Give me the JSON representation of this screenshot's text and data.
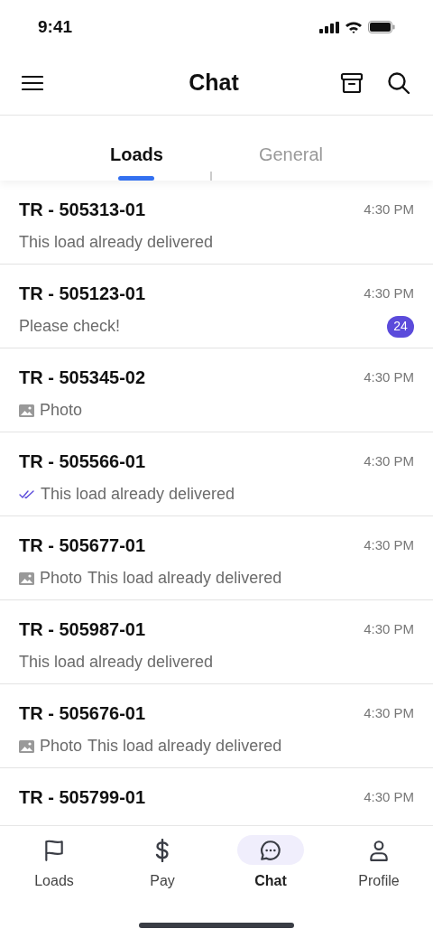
{
  "status_bar": {
    "time": "9:41"
  },
  "header": {
    "title": "Chat"
  },
  "tabs": [
    {
      "label": "Loads",
      "selected": true
    },
    {
      "label": "General",
      "selected": false
    }
  ],
  "chats": [
    {
      "title": "TR - 505313-01",
      "time": "4:30 PM",
      "read": false,
      "message": "This load already delivered"
    },
    {
      "title": "TR - 505123-01",
      "time": "4:30 PM",
      "read": false,
      "message": "Please check!",
      "unread_count": "24"
    },
    {
      "title": "TR - 505345-02",
      "time": "4:30 PM",
      "read": false,
      "photo_label": "Photo"
    },
    {
      "title": "TR - 505566-01",
      "time": "4:30 PM",
      "read": true,
      "message": "This load already delivered"
    },
    {
      "title": "TR - 505677-01",
      "time": "4:30 PM",
      "read": false,
      "photo_label": "Photo",
      "message": "This load already delivered"
    },
    {
      "title": "TR - 505987-01",
      "time": "4:30 PM",
      "read": false,
      "message": "This load already delivered"
    },
    {
      "title": "TR - 505676-01",
      "time": "4:30 PM",
      "read": false,
      "photo_label": "Photo",
      "message": "This load already delivered"
    },
    {
      "title": "TR - 505799-01",
      "time": "4:30 PM"
    }
  ],
  "bottom_nav": [
    {
      "kind": "flag",
      "label": "Loads",
      "selected": false
    },
    {
      "kind": "dollar",
      "label": "Pay",
      "selected": false
    },
    {
      "kind": "chat",
      "label": "Chat",
      "selected": true
    },
    {
      "kind": "person",
      "label": "Profile",
      "selected": false
    }
  ]
}
